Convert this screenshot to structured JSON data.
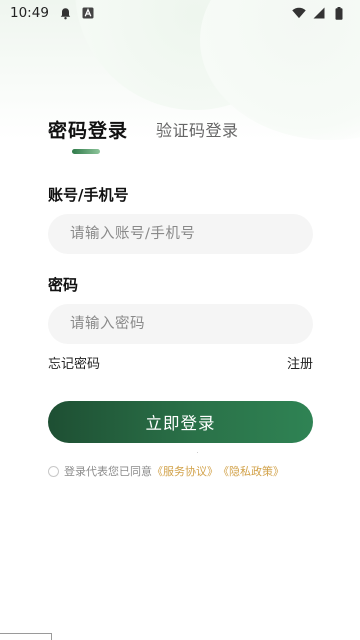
{
  "status_bar": {
    "time": "10:49",
    "icons": [
      "notification-bell-icon",
      "app-a-icon",
      "wifi-icon",
      "signal-icon",
      "battery-icon"
    ]
  },
  "tabs": {
    "active": "密码登录",
    "inactive": "验证码登录"
  },
  "form": {
    "account_label": "账号/手机号",
    "account_placeholder": "请输入账号/手机号",
    "account_value": "",
    "password_label": "密码",
    "password_placeholder": "请输入密码",
    "password_value": "",
    "forgot_password": "忘记密码",
    "register": "注册",
    "login_button": "立即登录"
  },
  "agreement": {
    "prefix": "登录代表您已同意",
    "service_link": "《服务协议》",
    "privacy_link": "《隐私政策》",
    "checked": false
  },
  "colors": {
    "primary_green_dark": "#1e4f33",
    "primary_green_light": "#2f8354",
    "link_gold": "#d2a24a",
    "input_bg": "#f5f5f5"
  }
}
